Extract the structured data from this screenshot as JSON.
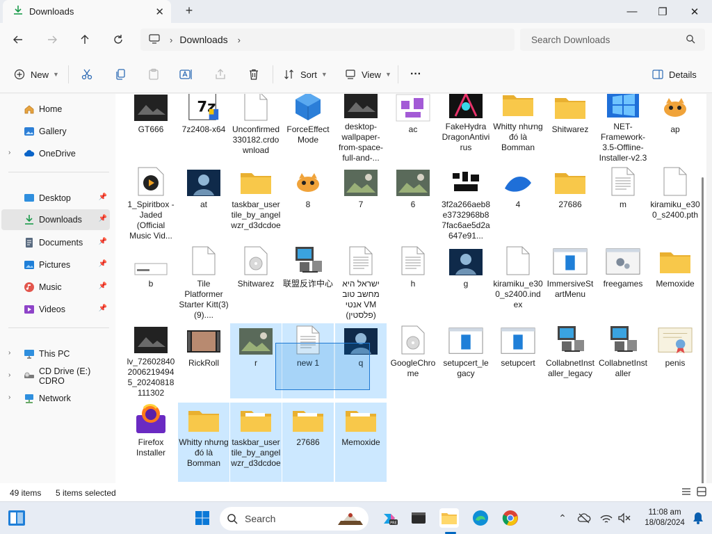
{
  "window": {
    "tab_title": "Downloads",
    "minimize": "—",
    "maximize": "❐",
    "close": "✕"
  },
  "address_bar": {
    "location": "Downloads",
    "search_placeholder": "Search Downloads"
  },
  "command_bar": {
    "new_label": "New",
    "sort_label": "Sort",
    "view_label": "View",
    "more_label": "···",
    "details_label": "Details"
  },
  "sidebar": {
    "items": [
      {
        "label": "Home",
        "icon": "home-icon"
      },
      {
        "label": "Gallery",
        "icon": "gallery-icon"
      },
      {
        "label": "OneDrive",
        "icon": "cloud-icon"
      },
      {
        "label": "Desktop",
        "icon": "desktop-icon"
      },
      {
        "label": "Downloads",
        "icon": "download-icon"
      },
      {
        "label": "Documents",
        "icon": "documents-icon"
      },
      {
        "label": "Pictures",
        "icon": "pictures-icon"
      },
      {
        "label": "Music",
        "icon": "music-icon"
      },
      {
        "label": "Videos",
        "icon": "videos-icon"
      },
      {
        "label": "This PC",
        "icon": "pc-icon"
      },
      {
        "label": "CD Drive (E:) CDRO",
        "icon": "cd-drive-icon"
      },
      {
        "label": "Network",
        "icon": "network-icon"
      }
    ]
  },
  "files": [
    {
      "name": "GT666",
      "type": "image-dark",
      "selected": false
    },
    {
      "name": "7z2408-x64",
      "type": "installer",
      "selected": false
    },
    {
      "name": "Unconfirmed 330182.crdownload",
      "type": "blank",
      "selected": false
    },
    {
      "name": "ForceEffect Mode",
      "type": "cube",
      "selected": false
    },
    {
      "name": "desktop-wallpaper-from-space-full-and-...",
      "type": "image-dark",
      "selected": false
    },
    {
      "name": "ac",
      "type": "image-purple",
      "selected": false
    },
    {
      "name": "FakeHydra DragonAntivirus",
      "type": "image-neon",
      "selected": false
    },
    {
      "name": "Whitty nhưng đó là Bomman",
      "type": "folder",
      "selected": false
    },
    {
      "name": "Shitwarez",
      "type": "folder",
      "selected": false
    },
    {
      "name": "NET-Framework-3.5-Offline-Installer-v2.3",
      "type": "windows",
      "selected": false
    },
    {
      "name": "ap",
      "type": "image-cat",
      "selected": false
    },
    {
      "name": "1_Spiritbox - Jaded (Official Music Vid...",
      "type": "media",
      "selected": false
    },
    {
      "name": "at",
      "type": "image-blue",
      "selected": false
    },
    {
      "name": "taskbar_usertile_by_angelwzr_d3dcdoe",
      "type": "folder",
      "selected": false
    },
    {
      "name": "8",
      "type": "image-cat",
      "selected": false
    },
    {
      "name": "7",
      "type": "image-photo",
      "selected": false
    },
    {
      "name": "6",
      "type": "image-photo",
      "selected": false
    },
    {
      "name": "3f2a266aeb8e3732968b87fac6ae5d2a647e91...",
      "type": "image-bw",
      "selected": false
    },
    {
      "name": "4",
      "type": "image-win",
      "selected": false
    },
    {
      "name": "27686",
      "type": "folder",
      "selected": false
    },
    {
      "name": "m",
      "type": "doc",
      "selected": false
    },
    {
      "name": "kiramiku_e300_s2400.pth",
      "type": "blank",
      "selected": false
    },
    {
      "name": "b",
      "type": "image-small",
      "selected": false
    },
    {
      "name": "Tile Platformer Starter Kitt(3)(9)....",
      "type": "blank",
      "selected": false
    },
    {
      "name": "Shitwarez",
      "type": "cd",
      "selected": false
    },
    {
      "name": "联盟反诈中心",
      "type": "installer-pc",
      "selected": false
    },
    {
      "name": "ישראל היא מחשב טוב אנטי VM (פלסטין)",
      "type": "doc",
      "selected": false
    },
    {
      "name": "h",
      "type": "doc",
      "selected": false
    },
    {
      "name": "g",
      "type": "image-blue",
      "selected": false
    },
    {
      "name": "kiramiku_e300_s2400.index",
      "type": "blank",
      "selected": false
    },
    {
      "name": "ImmersiveStartMenu",
      "type": "app",
      "selected": false
    },
    {
      "name": "freegames",
      "type": "gear-app",
      "selected": false
    },
    {
      "name": "Memoxide",
      "type": "folder",
      "selected": false
    },
    {
      "name": "lv_7260284020062194945_20240818111302",
      "type": "image-dark",
      "selected": false
    },
    {
      "name": "RickRoll",
      "type": "video",
      "selected": false
    },
    {
      "name": "r",
      "type": "image-photo",
      "selected": true
    },
    {
      "name": "new 1",
      "type": "doc",
      "selected": true
    },
    {
      "name": "q",
      "type": "image-blue",
      "selected": true
    },
    {
      "name": "GoogleChrome",
      "type": "cd",
      "selected": false
    },
    {
      "name": "setupcert_legacy",
      "type": "app",
      "selected": false
    },
    {
      "name": "setupcert",
      "type": "app",
      "selected": false
    },
    {
      "name": "CollabnetInstaller_legacy",
      "type": "installer-pc",
      "selected": false
    },
    {
      "name": "CollabnetInstaller",
      "type": "installer-pc",
      "selected": false
    },
    {
      "name": "penis",
      "type": "certificate",
      "selected": false
    },
    {
      "name": "Firefox Installer",
      "type": "firefox",
      "selected": false
    },
    {
      "name": "Whitty nhưng đó là Bomman",
      "type": "folder",
      "selected": true
    },
    {
      "name": "taskbar_usertile_by_angelwzr_d3dcdoe",
      "type": "folder-open",
      "selected": true
    },
    {
      "name": "27686",
      "type": "folder-open",
      "selected": true
    },
    {
      "name": "Memoxide",
      "type": "folder-open",
      "selected": true
    }
  ],
  "status": {
    "count": "49 items",
    "selected": "5 items selected"
  },
  "taskbar": {
    "search_label": "Search",
    "time": "11:08 am",
    "date": "18/08/2024"
  },
  "colors": {
    "selection": "#cce8ff",
    "accent": "#0067c0",
    "folder": "#f8c84a"
  }
}
